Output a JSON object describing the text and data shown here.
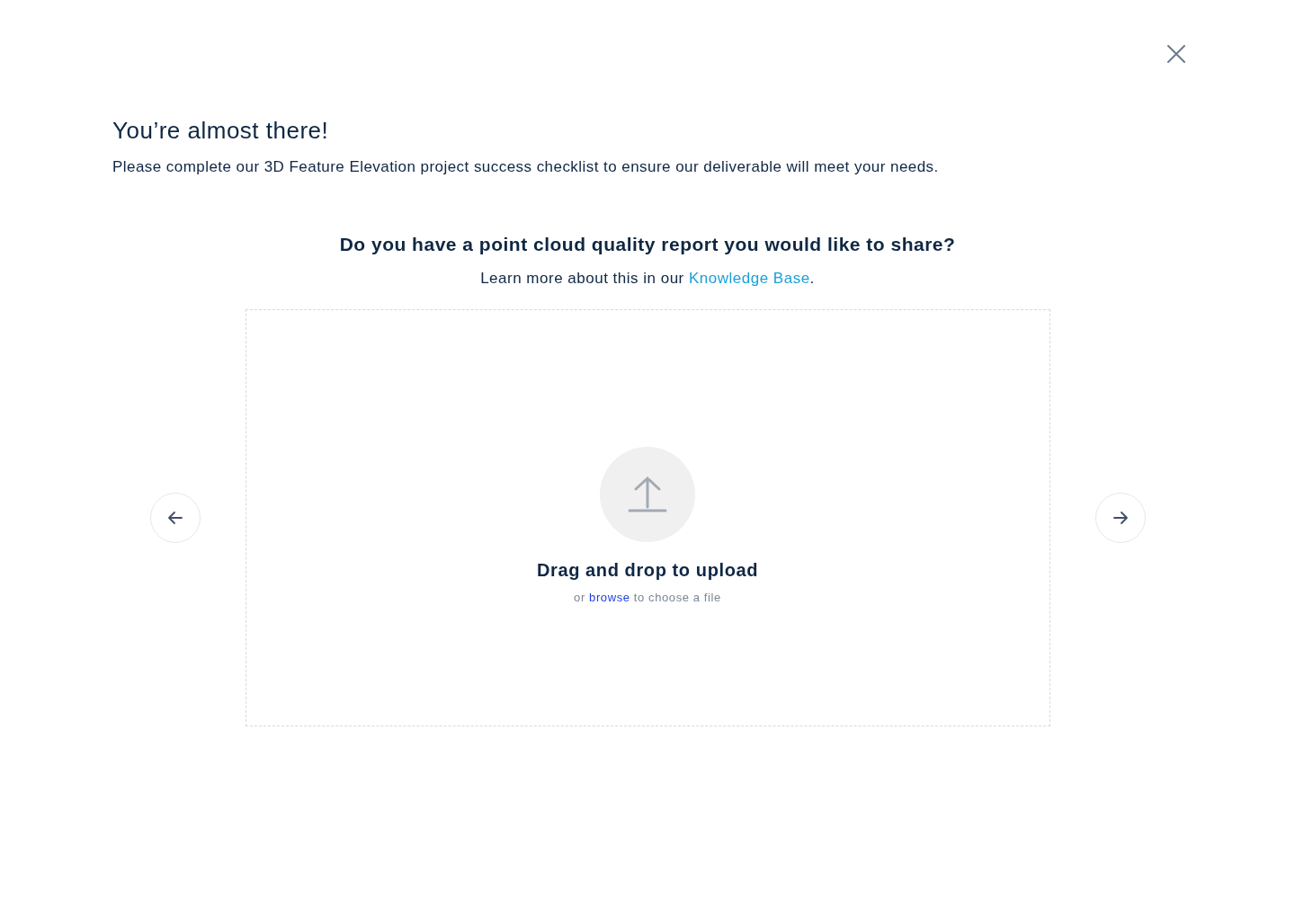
{
  "title": "You’re almost there!",
  "subtitle": "Please complete our 3D Feature Elevation project success checklist to ensure our deliverable will meet your needs.",
  "question": {
    "heading": "Do you have a point cloud quality report you would like to share?",
    "learn_more": {
      "before": "Learn more about this in our ",
      "link": "Knowledge Base",
      "after": "."
    }
  },
  "upload": {
    "heading": "Drag and drop to upload",
    "hint_before": "or ",
    "browse_link": "browse",
    "hint_after": " to choose a file"
  },
  "navigation": {
    "previous": {
      "disabled": false
    },
    "next": {
      "disabled": false
    }
  }
}
